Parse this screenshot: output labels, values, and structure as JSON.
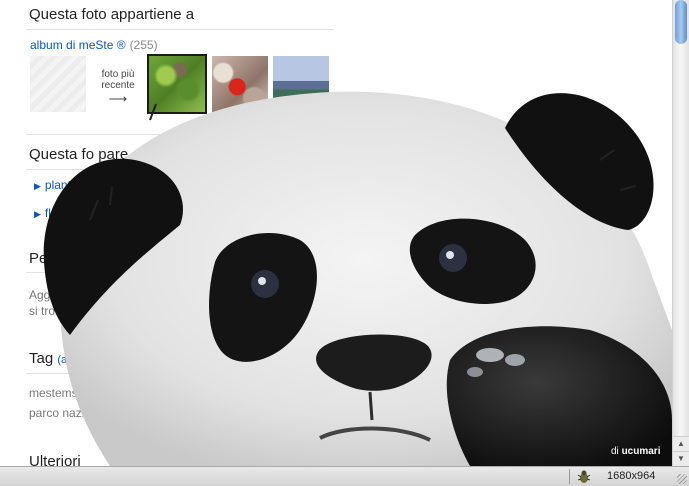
{
  "sections": {
    "belongs_title": "Questa foto appartiene a",
    "album_link": "album di meSte ®",
    "album_count": "(255)",
    "next_photo_label": "foto più recente",
    "next_arrow": "⟶",
    "also_in_title": "Questa fo     pare anche in",
    "also_in_links": [
      "plant",
      "flo"
    ],
    "people_title": "Per",
    "people_text_1": "Agg",
    "people_text_2": "si tro",
    "tags_title": "Tag",
    "tags_add": "(aggiun",
    "tags": [
      "mestems ×",
      "parco nazio"
    ],
    "more_title": "Ulteriori"
  },
  "overlay": {
    "credit_prefix": "di",
    "credit_user": "ucumari"
  },
  "statusbar": {
    "resolution": "1680x964"
  },
  "colors": {
    "link": "#0a58b8",
    "scroll_thumb": "#6f9fd8"
  }
}
